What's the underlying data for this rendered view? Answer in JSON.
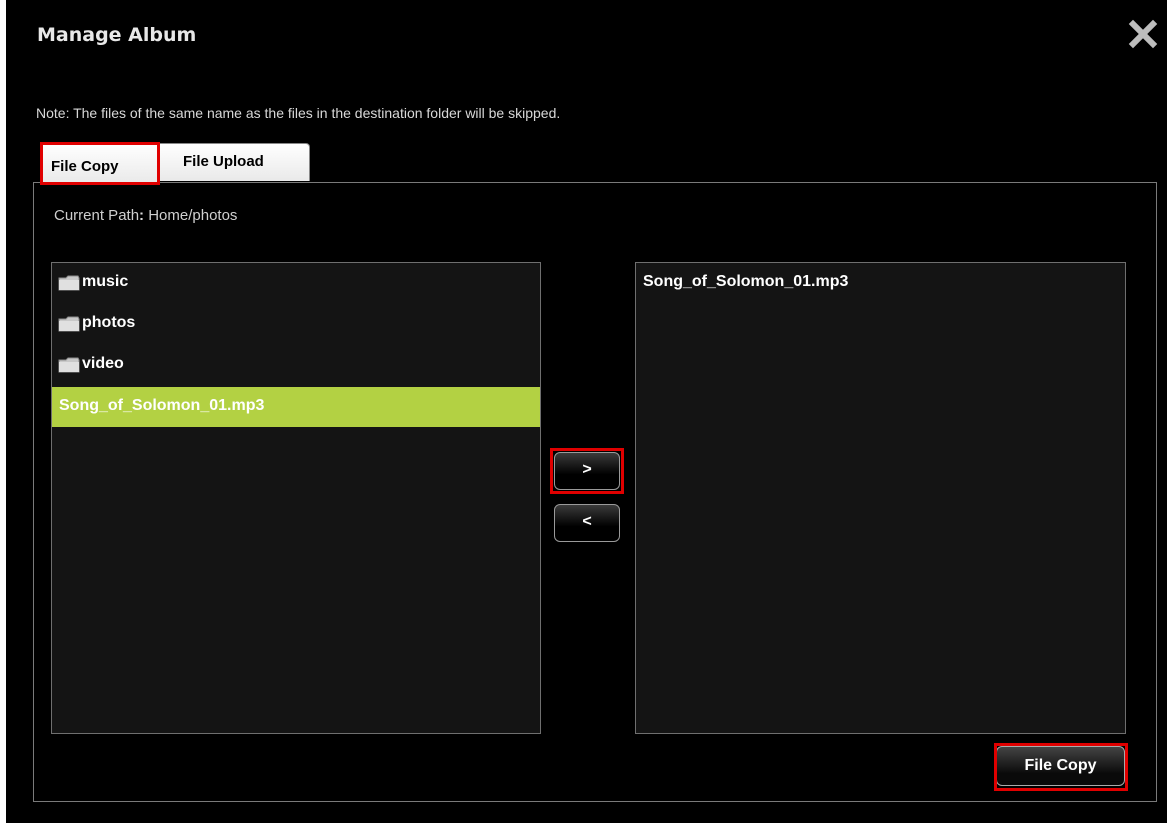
{
  "dialog": {
    "title": "Manage Album",
    "close_icon": "close-icon"
  },
  "note": "Note: The files of the same name as the files in the destination folder will be skipped.",
  "tabs": [
    {
      "label": "File Copy",
      "active": true
    },
    {
      "label": "File Upload",
      "active": false
    }
  ],
  "path": {
    "label": "Current Path",
    "separator": ":",
    "value": "Home/photos"
  },
  "source_list": {
    "items": [
      {
        "label": "music",
        "type": "folder",
        "icon": "folder-icon"
      },
      {
        "label": "photos",
        "type": "folder",
        "icon": "folder-icon"
      },
      {
        "label": "video",
        "type": "folder",
        "icon": "folder-icon"
      },
      {
        "label": "Song_of_Solomon_01.mp3",
        "type": "file",
        "selected": true
      }
    ]
  },
  "destination_list": {
    "items": [
      {
        "label": "Song_of_Solomon_01.mp3",
        "type": "file"
      }
    ]
  },
  "buttons": {
    "move_right": ">",
    "move_left": "<",
    "file_copy": "File Copy"
  },
  "colors": {
    "background": "#000000",
    "selected_row": "#b3d143",
    "highlight_box": "#e00000"
  }
}
